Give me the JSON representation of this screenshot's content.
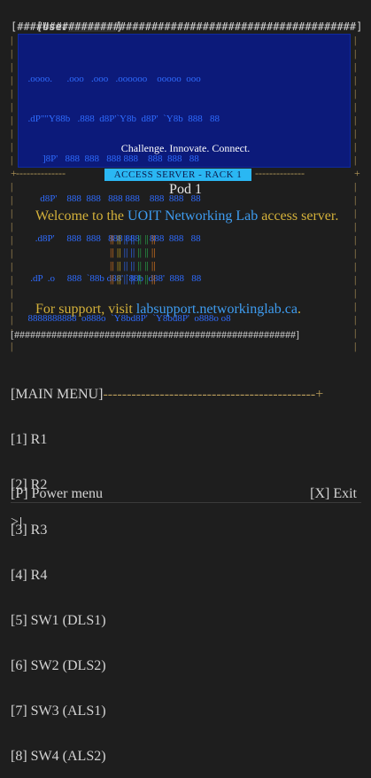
{
  "user_line": {
    "label": "[User",
    "close": "]"
  },
  "banner": {
    "border_top": "[#####################################################]",
    "border_bottom": "[#####################################################]",
    "ascii_art": [
      "  .oooo.      .ooo   .ooo   .oooooo    ooooo  ooo",
      "  .dP\"\"Y88b   .888  d8P'`Y8b  d8P'  `Y8b  888   88",
      "        ]8P'   888  888   888 888    888  888   88",
      "       d8P'    888  888   888 888    888  888   88",
      "     .d8P'     888  888   888 888    888  888   88",
      "   .dP  .o     888  `88b d88' `88b  d88'  888   88",
      "  8888888888  o888o  `Y8bd8P'  `Y8bd8P'  o888o o8"
    ],
    "tagline": "Challenge. Innovate. Connect."
  },
  "section_tag": "ACCESS SERVER - RACK 1",
  "pod": "Pod 1",
  "welcome": {
    "before": "Welcome to the ",
    "accent": "UOIT Networking Lab",
    "after": " access server."
  },
  "support": {
    "before": "For support, visit ",
    "accent": "labsupport.networkinglab.ca",
    "after": "."
  },
  "menu": {
    "header": "[MAIN MENU]",
    "items": [
      "[1] R1",
      "[2] R2",
      "[3] R3",
      "[4] R4",
      "[5] SW1 (DLS1)",
      "[6] SW2 (DLS2)",
      "[7] SW3 (ALS1)",
      "[8] SW4 (ALS2)"
    ],
    "power": "[P] Power menu",
    "exit": "[X] Exit"
  },
  "prompt": ">",
  "colors": {
    "banner_bg": "#0c1a7a",
    "ascii": "#2f6cff",
    "tag_bg": "#2ab7f3",
    "accent_link": "#3e9cf0",
    "body_text": "#d4b13a",
    "cable_orange": "#e07a1f",
    "cable_yellow": "#d8b21a",
    "cable_blue": "#2f6cff",
    "cable_green": "#2aa84a"
  }
}
